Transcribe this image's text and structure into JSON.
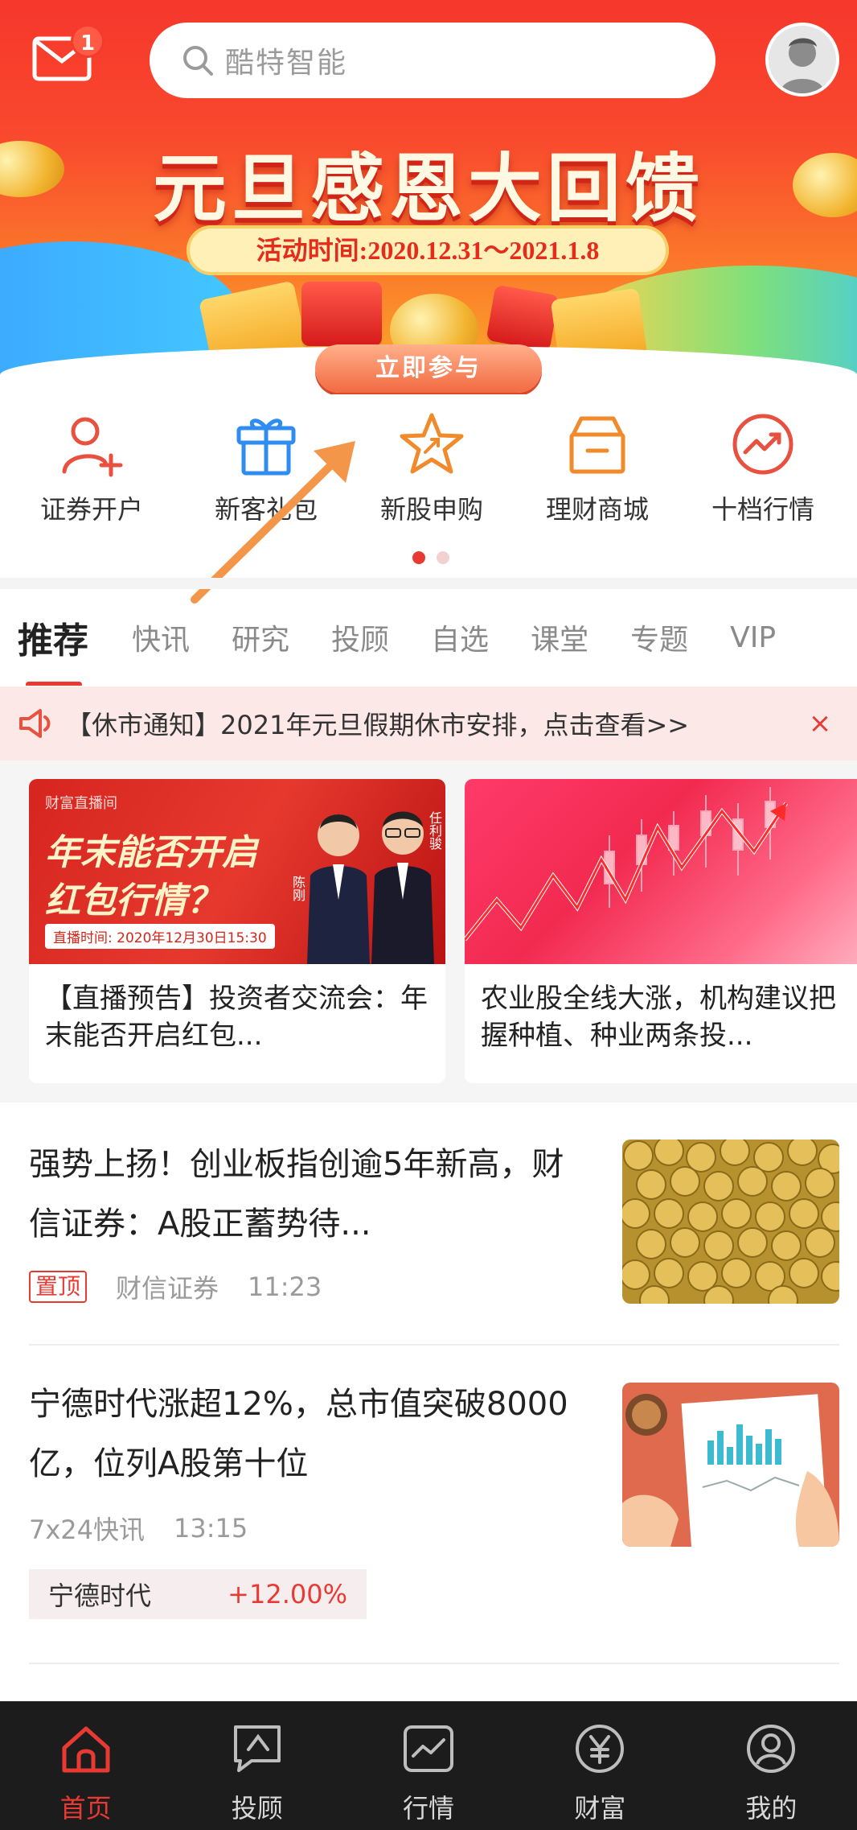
{
  "header": {
    "mail_badge": "1",
    "search_placeholder": "酷特智能"
  },
  "banner": {
    "title": "元旦感恩大回馈",
    "date_range": "活动时间:2020.12.31～2021.1.8",
    "join_label": "立即参与"
  },
  "quick_entries": [
    {
      "label": "证券开户",
      "icon": "add-user-icon"
    },
    {
      "label": "新客礼包",
      "icon": "gift-icon"
    },
    {
      "label": "新股申购",
      "icon": "star-icon"
    },
    {
      "label": "理财商城",
      "icon": "shop-box-icon"
    },
    {
      "label": "十档行情",
      "icon": "trend-icon"
    }
  ],
  "tabs": [
    "推荐",
    "快讯",
    "研究",
    "投顾",
    "自选",
    "课堂",
    "专题",
    "VIP"
  ],
  "notice": {
    "text": "【休市通知】2021年元旦假期休市安排，点击查看>>",
    "close": "×"
  },
  "cards": [
    {
      "title": "【直播预告】投资者交流会：年末能否开启红包...",
      "image": {
        "channel": "财富直播间",
        "headline_1": "年末能否开启",
        "headline_2": "红包行情？",
        "time": "直播时间: 2020年12月30日15:30",
        "name_1": "陈刚",
        "name_2": "任利骏"
      }
    },
    {
      "title": "农业股全线大涨，机构建议把握种植、种业两条投..."
    }
  ],
  "news": [
    {
      "title": "强势上扬！创业板指创逾5年新高，财信证券：A股正蓄势待...",
      "pin": "置顶",
      "source": "财信证券",
      "time": "11:23"
    },
    {
      "title": "宁德时代涨超12%，总市值突破8000亿，位列A股第十位",
      "source": "7x24快讯",
      "time": "13:15",
      "stock_name": "宁德时代",
      "stock_change": "+12.00%"
    }
  ],
  "bottom_nav": [
    {
      "label": "首页",
      "icon": "home-icon",
      "active": true
    },
    {
      "label": "投顾",
      "icon": "advisor-icon"
    },
    {
      "label": "行情",
      "icon": "market-icon"
    },
    {
      "label": "财富",
      "icon": "wealth-icon"
    },
    {
      "label": "我的",
      "icon": "profile-icon"
    }
  ],
  "colors": {
    "accent": "#e83a32",
    "banner_red": "#f6372b",
    "nav_bg": "#1c1c1c"
  }
}
